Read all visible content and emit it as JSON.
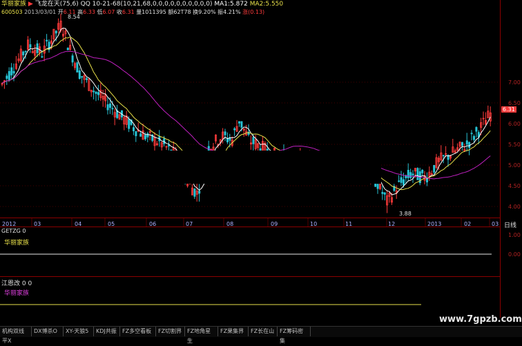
{
  "header": {
    "stock_name": "华丽家族",
    "period_tag": "飞龙在天(75,6) QQ",
    "params": "10-21-68(10,21,68,0,0,0,0,0,0,0,0,0,0)",
    "ma1": "MA1:5.872",
    "ma2": "MA2:5.550",
    "code": "600503",
    "date": "2013/03/01",
    "open_label": "开",
    "open_value": "6.11",
    "high_label": "高",
    "high_value": "6.33",
    "low_label": "低",
    "low_value": "6.07",
    "close_label": "收",
    "close_value": "6.31",
    "volume": "量1011395",
    "amount": "额62T78",
    "turnover": "换9.20%",
    "amplitude": "振4.21%",
    "change": "涨(0.13)"
  },
  "colors": {
    "up": "#ff3b3b",
    "down": "#27c2d4",
    "ma_short": "#ffffff",
    "ma_mid": "#e8e04a",
    "ma_long": "#c020c0",
    "grid": "#8b0000",
    "axis_text": "#b22222",
    "x_label": "#b0b0ff"
  },
  "price_axis": {
    "ticks": [
      "7.00",
      "6.50",
      "6.00",
      "5.50",
      "5.00",
      "4.50",
      "4.00"
    ],
    "current_price": "6.31",
    "max_marker": "8.54",
    "min_marker": "3.88"
  },
  "time_axis": {
    "labels": [
      "2012",
      "03",
      "04",
      "05",
      "06",
      "07",
      "08",
      "09",
      "10",
      "11",
      "12",
      "2013",
      "02",
      "03"
    ],
    "period": "日线"
  },
  "panel1": {
    "title": "GETZG",
    "value": "0",
    "name": "华丽家族",
    "ticks": [
      "1.00",
      "0.00"
    ]
  },
  "panel2": {
    "title": "江恩改",
    "values": "0 0",
    "name": "华丽家族"
  },
  "watermark": "www.7gpzb.com",
  "tabs": [
    "机构双线平X",
    "DX博杀O",
    "XY-天狼5",
    "KDJ共振",
    "FZ多空看板",
    "FZ切割界",
    "FZ地角星生",
    "FZ果集界",
    "FZ长在山",
    "FZ筹码密集"
  ]
}
